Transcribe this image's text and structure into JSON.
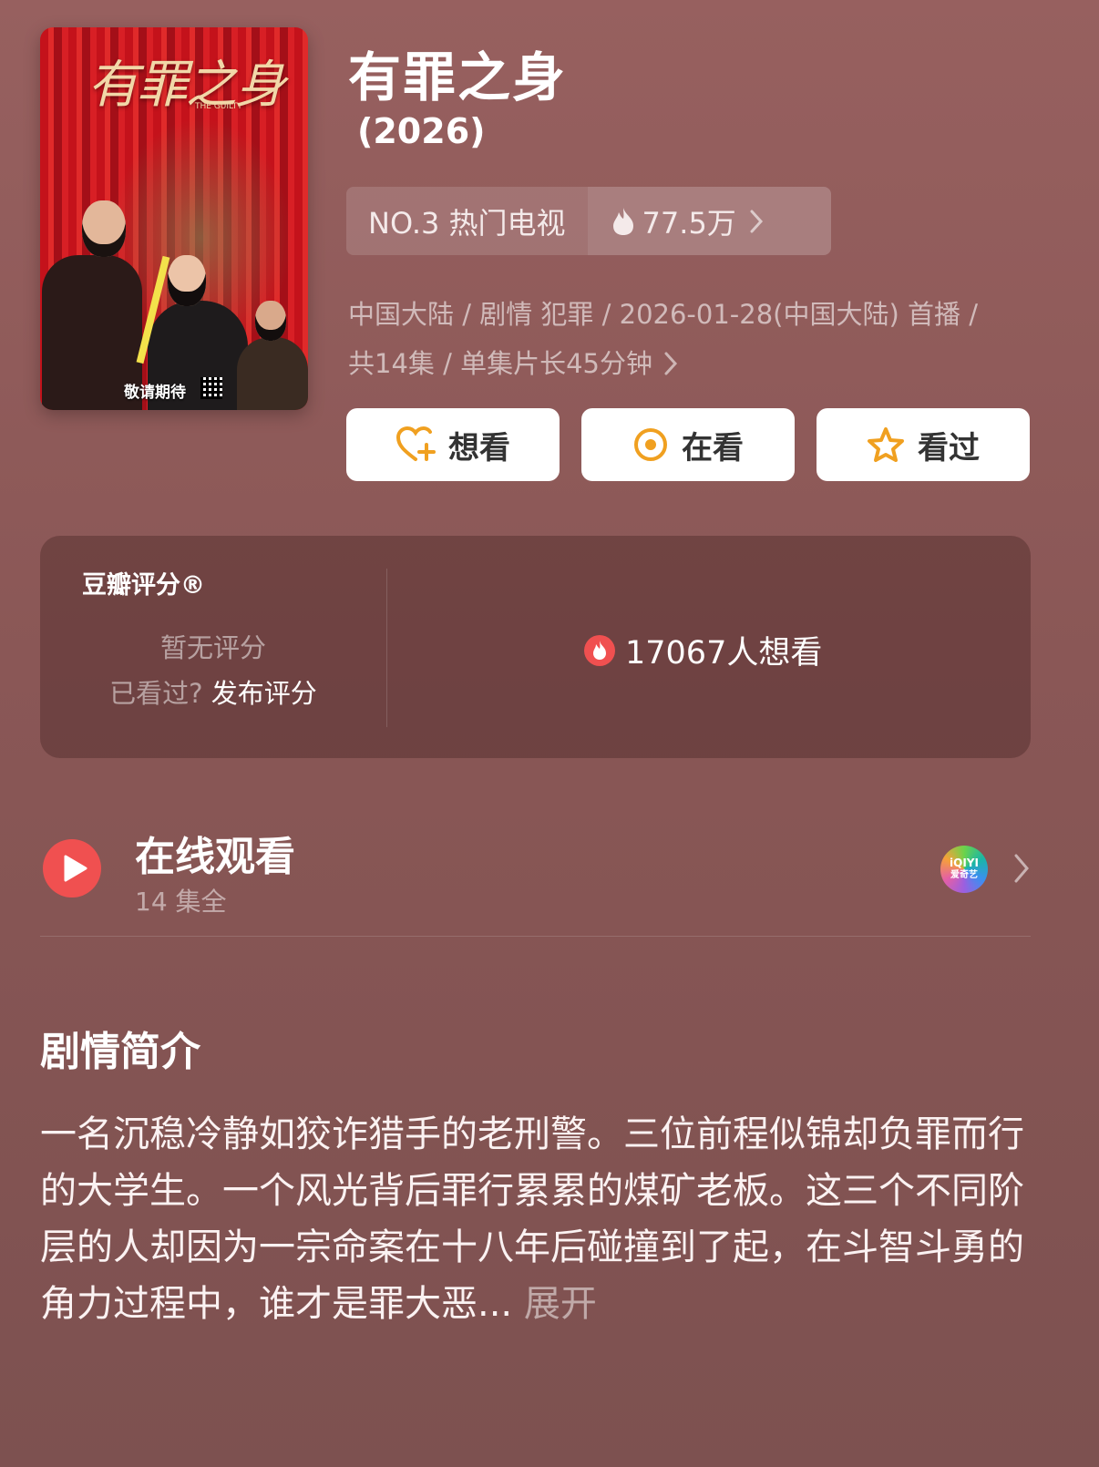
{
  "poster": {
    "title_art": "有罪之身",
    "subtitle_art": "THE GUILTY",
    "badge": "敬请期待"
  },
  "show": {
    "title": "有罪之身",
    "year": "(2026)"
  },
  "ranking": {
    "label": "NO.3 热门电视",
    "heat": "77.5万"
  },
  "meta": {
    "line1": "中国大陆 / 剧情 犯罪 / 2026-01-28(中国大陆) 首播 /",
    "line2": "共14集 / 单集片长45分钟"
  },
  "actions": {
    "want": "想看",
    "watching": "在看",
    "watched": "看过"
  },
  "rating": {
    "brand": "豆瓣评分®",
    "none": "暂无评分",
    "prompt": "已看过?",
    "prompt_link": "发布评分",
    "wish_count": "17067人想看"
  },
  "online": {
    "title": "在线观看",
    "episodes": "14 集全",
    "provider_top": "iQIYI",
    "provider_bottom": "爱奇艺"
  },
  "synopsis": {
    "heading": "剧情简介",
    "text": "一名沉稳冷静如狡诈猎手的老刑警。三位前程似锦却负罪而行的大学生。一个风光背后罪行累累的煤矿老板。这三个不同阶层的人却因为一宗命案在十八年后碰撞到了起，在斗智斗勇的角力过程中，谁才是罪大恶...",
    "more": "展开"
  },
  "colors": {
    "background": "#8f5b5a",
    "accent_orange": "#f0a020",
    "play_red": "#f05050"
  }
}
